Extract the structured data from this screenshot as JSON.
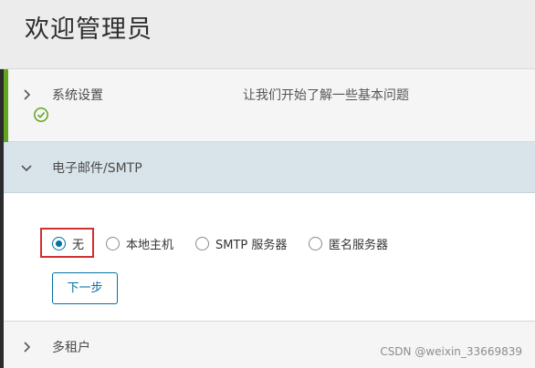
{
  "header": {
    "title": "欢迎管理员"
  },
  "sections": [
    {
      "label": "系统设置",
      "description": "让我们开始了解一些基本问题",
      "status": "completed"
    },
    {
      "label": "电子邮件/SMTP",
      "expanded": true
    },
    {
      "label": "多租户"
    }
  ],
  "smtp": {
    "options": [
      {
        "label": "无",
        "selected": true
      },
      {
        "label": "本地主机",
        "selected": false
      },
      {
        "label": "SMTP 服务器",
        "selected": false
      },
      {
        "label": "匿名服务器",
        "selected": false
      }
    ],
    "next_label": "下一步"
  },
  "watermark": "CSDN @weixin_33669839",
  "colors": {
    "accent_green": "#62a420",
    "primary_blue": "#0072a3",
    "highlight_red": "#d32f2f"
  }
}
